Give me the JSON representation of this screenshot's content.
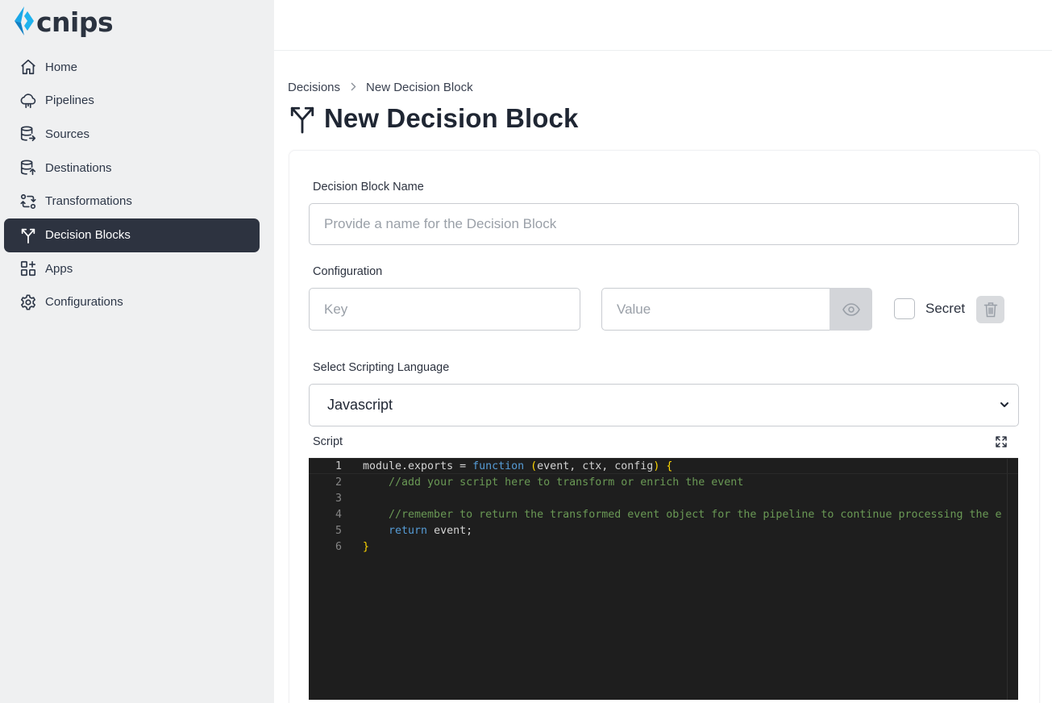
{
  "app": {
    "logo_text": "cnips"
  },
  "sidebar": {
    "items": [
      {
        "label": "Home",
        "icon": "home-icon"
      },
      {
        "label": "Pipelines",
        "icon": "cloud-icon"
      },
      {
        "label": "Sources",
        "icon": "database-arrow-icon"
      },
      {
        "label": "Destinations",
        "icon": "database-upload-icon"
      },
      {
        "label": "Transformations",
        "icon": "transform-icon"
      },
      {
        "label": "Decision Blocks",
        "icon": "fork-icon",
        "active": true
      },
      {
        "label": "Apps",
        "icon": "apps-add-icon"
      },
      {
        "label": "Configurations",
        "icon": "gear-icon"
      }
    ]
  },
  "breadcrumb": {
    "parent": "Decisions",
    "current": "New Decision Block"
  },
  "page": {
    "title": "New Decision Block"
  },
  "form": {
    "name_label": "Decision Block Name",
    "name_placeholder": "Provide a name for the Decision Block",
    "config_label": "Configuration",
    "key_placeholder": "Key",
    "value_placeholder": "Value",
    "secret_label": "Secret",
    "language_label": "Select Scripting Language",
    "language_selected": "Javascript",
    "script_label": "Script"
  },
  "editor": {
    "lines": [
      {
        "n": "1"
      },
      {
        "n": "2",
        "text": "    //add your script here to transform or enrich the event"
      },
      {
        "n": "3"
      },
      {
        "n": "4",
        "text": "    //remember to return the transformed event object for the pipeline to continue processing the e"
      },
      {
        "n": "5"
      },
      {
        "n": "6"
      }
    ],
    "line1": {
      "a": "module.exports = ",
      "kw": "function",
      "b": " ",
      "p1": "(",
      "args": "event, ",
      "ctx": "ctx",
      "c": ", ",
      "config": "config",
      "p2": ")",
      "d": " ",
      "brace": "{"
    },
    "line5": {
      "indent": "    ",
      "kw": "return",
      "rest": " event;"
    },
    "line6": {
      "brace": "}"
    }
  },
  "colors": {
    "sidebar_bg": "#eff0f1",
    "active_bg": "#2d3340",
    "editor_bg": "#1e1e1e"
  }
}
